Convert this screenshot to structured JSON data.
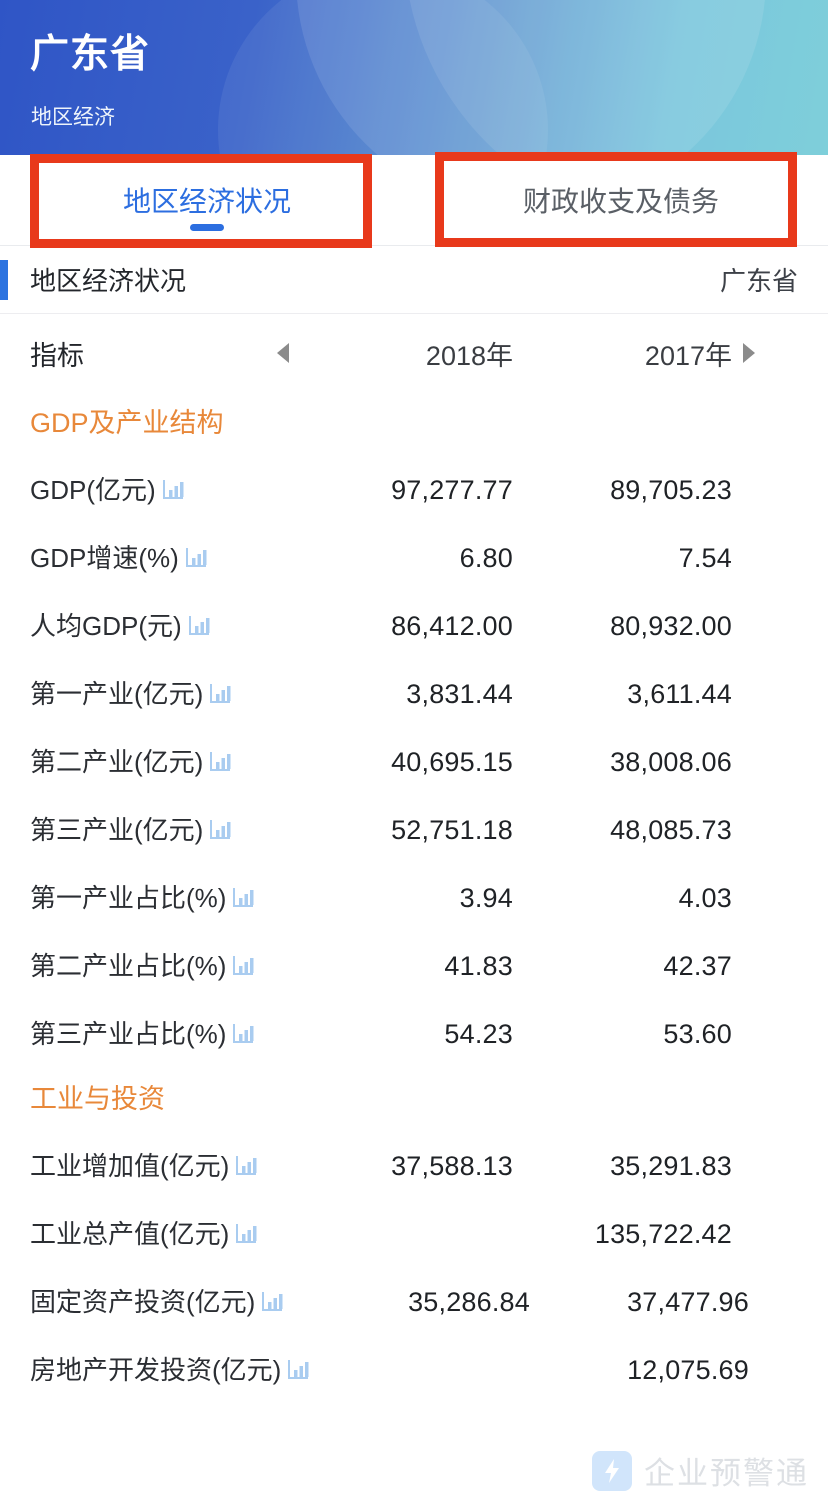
{
  "banner": {
    "title": "广东省",
    "subtitle": "地区经济"
  },
  "tabs": [
    {
      "label": "地区经济状况",
      "active": true
    },
    {
      "label": "财政收支及债务",
      "active": false
    }
  ],
  "subheader": {
    "left": "地区经济状况",
    "right": "广东省"
  },
  "table": {
    "index_header": "指标",
    "prev_arrow": "left-triangle",
    "next_arrow": "right-triangle",
    "columns": [
      "2018年",
      "2017年"
    ],
    "sections": [
      {
        "title": "GDP及产业结构",
        "rows": [
          {
            "label": "GDP(亿元)",
            "icon": "bar-chart-icon",
            "values": [
              "97,277.77",
              "89,705.23"
            ]
          },
          {
            "label": "GDP增速(%)",
            "icon": "bar-chart-icon",
            "values": [
              "6.80",
              "7.54"
            ]
          },
          {
            "label": "人均GDP(元)",
            "icon": "bar-chart-icon",
            "values": [
              "86,412.00",
              "80,932.00"
            ]
          },
          {
            "label": "第一产业(亿元)",
            "icon": "bar-chart-icon",
            "values": [
              "3,831.44",
              "3,611.44"
            ]
          },
          {
            "label": "第二产业(亿元)",
            "icon": "bar-chart-icon",
            "values": [
              "40,695.15",
              "38,008.06"
            ]
          },
          {
            "label": "第三产业(亿元)",
            "icon": "bar-chart-icon",
            "values": [
              "52,751.18",
              "48,085.73"
            ]
          },
          {
            "label": "第一产业占比(%)",
            "icon": "bar-chart-icon",
            "values": [
              "3.94",
              "4.03"
            ]
          },
          {
            "label": "第二产业占比(%)",
            "icon": "bar-chart-icon",
            "values": [
              "41.83",
              "42.37"
            ]
          },
          {
            "label": "第三产业占比(%)",
            "icon": "bar-chart-icon",
            "values": [
              "54.23",
              "53.60"
            ]
          }
        ]
      },
      {
        "title": "工业与投资",
        "rows": [
          {
            "label": "工业增加值(亿元)",
            "icon": "bar-chart-icon",
            "values": [
              "37,588.13",
              "35,291.83"
            ]
          },
          {
            "label": "工业总产值(亿元)",
            "icon": "bar-chart-icon",
            "values": [
              "",
              "135,722.42"
            ]
          },
          {
            "label": "固定资产投资(亿元)",
            "icon": "bar-chart-icon",
            "wrap": true,
            "values": [
              "35,286.84",
              "37,477.96"
            ]
          },
          {
            "label": "房地产开发投资(亿元)",
            "icon": "bar-chart-icon",
            "wrap": true,
            "values": [
              "",
              "12,075.69"
            ]
          }
        ]
      }
    ]
  },
  "watermark": {
    "text": "企业预警通",
    "icon": "lightning-bolt-icon"
  },
  "colors": {
    "banner_left": "#2f55c6",
    "banner_right": "#72cbd7",
    "tab_active": "#2c6ee0",
    "accent_bar": "#2c73e0",
    "section_title": "#e8883a",
    "annotation": "#e8391b",
    "chart_icon": "#a9ccf0"
  }
}
